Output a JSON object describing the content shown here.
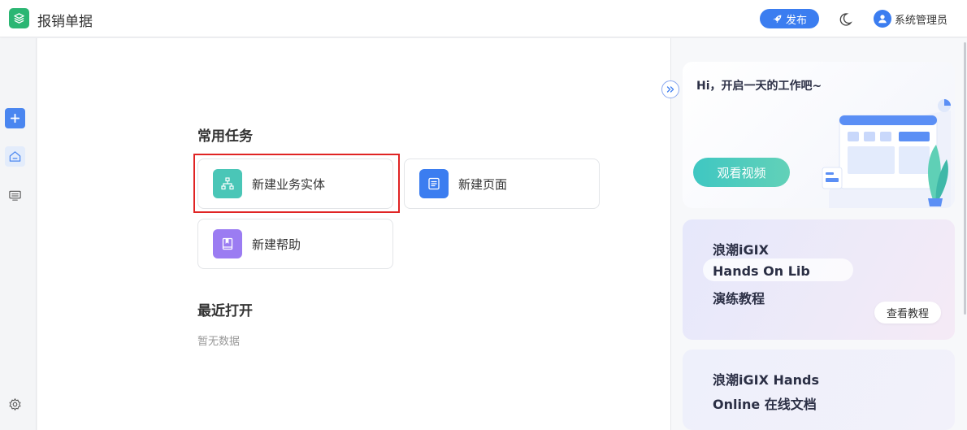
{
  "header": {
    "app_title": "报销单据",
    "publish_label": "发布",
    "user_name": "系统管理员"
  },
  "rail": {
    "icons": [
      "add-icon",
      "home-icon",
      "monitor-icon",
      "gear-icon"
    ]
  },
  "main": {
    "tasks_title": "常用任务",
    "tasks": [
      {
        "label": "新建业务实体",
        "icon": "org-chart-icon",
        "color": "#4ac6b7"
      },
      {
        "label": "新建页面",
        "icon": "page-icon",
        "color": "#3b7df0"
      },
      {
        "label": "新建帮助",
        "icon": "book-icon",
        "color": "#9b7cf2"
      }
    ],
    "recent_title": "最近打开",
    "recent_empty": "暂无数据"
  },
  "right": {
    "greeting": "Hi，开启一天的工作吧~",
    "watch_label": "观看视频",
    "promo_a": {
      "lines": [
        "浪潮iGIX",
        "Hands On Lib",
        "演练教程"
      ],
      "button": "查看教程"
    },
    "promo_b": {
      "lines": [
        "浪潮iGIX Hands",
        "Online 在线文档"
      ]
    }
  },
  "colors": {
    "accent": "#3b7df0",
    "brand_green": "#2bb673",
    "teal": "#3fc7c2",
    "selection_outline": "#e02424"
  }
}
